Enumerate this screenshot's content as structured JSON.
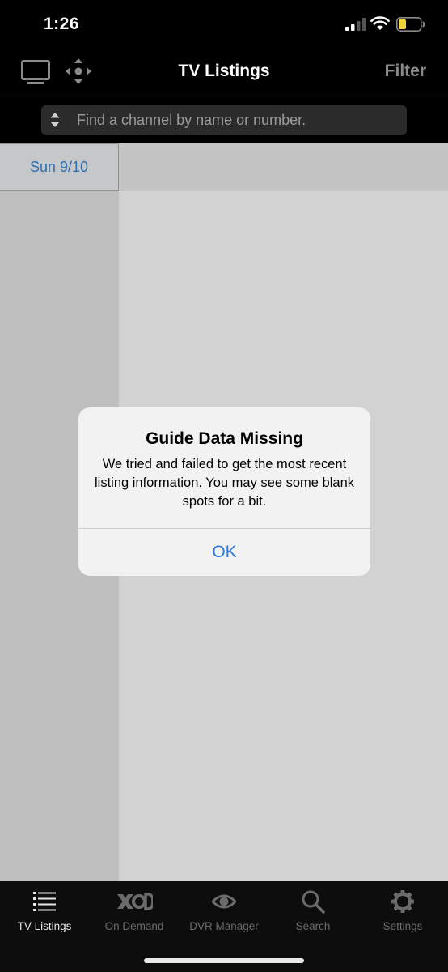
{
  "status_bar": {
    "time": "1:26",
    "battery_color": "#f5d33d"
  },
  "header": {
    "title": "TV Listings",
    "filter_label": "Filter",
    "left_icons": [
      "tv-icon",
      "remote-dpad-icon"
    ]
  },
  "search": {
    "placeholder": "Find a channel by name or number."
  },
  "guide": {
    "date_label": "Sun 9/10"
  },
  "alert": {
    "title": "Guide Data Missing",
    "message": "We tried and failed to get the most recent listing information. You may see some blank spots for a bit.",
    "ok_label": "OK"
  },
  "tabs": [
    {
      "label": "TV Listings",
      "icon": "list-icon",
      "active": true
    },
    {
      "label": "On Demand",
      "icon": "xod-icon",
      "active": false
    },
    {
      "label": "DVR Manager",
      "icon": "eye-icon",
      "active": false
    },
    {
      "label": "Search",
      "icon": "search-icon",
      "active": false
    },
    {
      "label": "Settings",
      "icon": "gear-icon",
      "active": false
    }
  ],
  "colors": {
    "accent_blue": "#2f7ad8",
    "date_blue": "#2f6fb0",
    "inactive_tab": "#6b6b6b"
  }
}
